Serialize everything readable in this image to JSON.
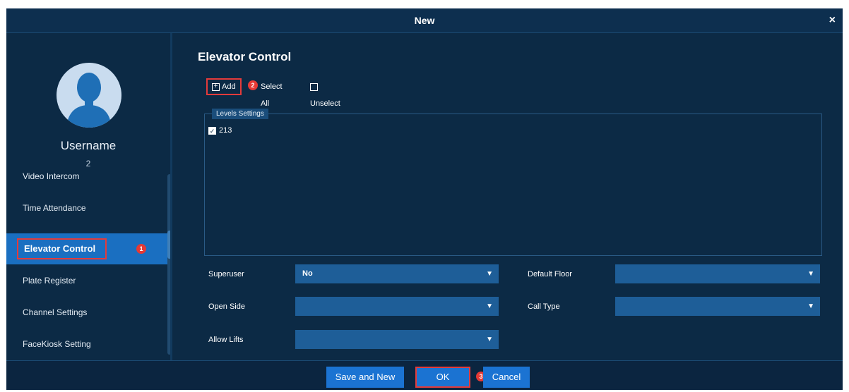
{
  "dialog": {
    "title": "New",
    "close_label": "×"
  },
  "user": {
    "name": "Username",
    "id": "2"
  },
  "sidebar": {
    "items": [
      {
        "label": "Video Intercom"
      },
      {
        "label": "Time Attendance"
      },
      {
        "label": "Elevator Control",
        "active": true,
        "badge": "1"
      },
      {
        "label": "Plate Register"
      },
      {
        "label": "Channel Settings"
      },
      {
        "label": "FaceKiosk Setting"
      }
    ]
  },
  "main": {
    "title": "Elevator Control",
    "toolbar": {
      "add_label": "Add",
      "add_badge": "2",
      "select_all_label": "Select All",
      "unselect_all_label": "Unselect All"
    },
    "levels": {
      "legend": "Levels Settings",
      "items": [
        {
          "label": "213",
          "checked": true
        }
      ]
    },
    "fields": {
      "superuser": {
        "label": "Superuser",
        "value": "No"
      },
      "default_floor": {
        "label": "Default Floor",
        "value": ""
      },
      "open_side": {
        "label": "Open Side",
        "value": ""
      },
      "call_type": {
        "label": "Call Type",
        "value": ""
      },
      "allow_lifts": {
        "label": "Allow Lifts",
        "value": ""
      }
    }
  },
  "footer": {
    "save_and_new_label": "Save and New",
    "ok_label": "OK",
    "cancel_label": "Cancel",
    "cancel_badge": "3"
  },
  "colors": {
    "background": "#0c2a45",
    "accent": "#1b73d2",
    "highlight": "#e33b3b",
    "select": "#1e5e98"
  },
  "icons": {
    "close": "close-icon",
    "avatar": "user-silhouette-icon",
    "add": "plus-square-icon",
    "chevron": "chevron-down-icon",
    "checkbox": "checkbox-icon"
  }
}
